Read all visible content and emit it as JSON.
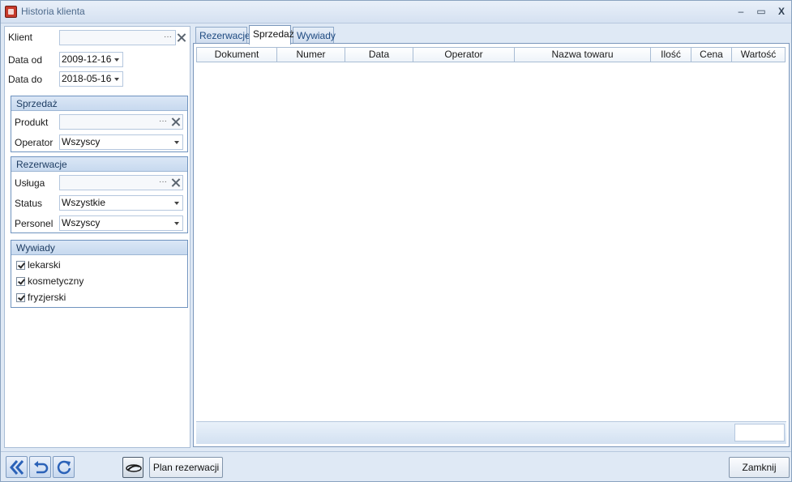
{
  "window": {
    "title": "Historia klienta",
    "minimize": "–",
    "maximize": "▭",
    "close": "X"
  },
  "filters": {
    "client_label": "Klient",
    "client_value": "",
    "date_from_label": "Data od",
    "date_from_value": "2009-12-16",
    "date_to_label": "Data do",
    "date_to_value": "2018-05-16",
    "ellipsis": "···"
  },
  "sales_group": {
    "title": "Sprzedaż",
    "product_label": "Produkt",
    "product_value": "",
    "operator_label": "Operator",
    "operator_value": "Wszyscy"
  },
  "reservations_group": {
    "title": "Rezerwacje",
    "service_label": "Usługa",
    "service_value": "",
    "status_label": "Status",
    "status_value": "Wszystkie",
    "staff_label": "Personel",
    "staff_value": "Wszyscy"
  },
  "interviews_group": {
    "title": "Wywiady",
    "options": [
      {
        "label": "lekarski",
        "checked": true
      },
      {
        "label": "kosmetyczny",
        "checked": true
      },
      {
        "label": "fryzjerski",
        "checked": true
      }
    ]
  },
  "tabs": [
    {
      "label": "Rezerwacje",
      "active": false
    },
    {
      "label": "Sprzedaż",
      "active": true
    },
    {
      "label": "Wywiady",
      "active": false
    }
  ],
  "grid": {
    "columns": [
      "Dokument",
      "Numer",
      "Data",
      "Operator",
      "Nazwa towaru",
      "Ilość",
      "Cena",
      "Wartość"
    ],
    "rows": []
  },
  "bottom": {
    "plan_button": "Plan rezerwacji",
    "close_button": "Zamknij"
  },
  "colors": {
    "window_bg": "#dfe9f5",
    "group_border": "#6f93bf",
    "tab_text": "#1e4a80"
  }
}
